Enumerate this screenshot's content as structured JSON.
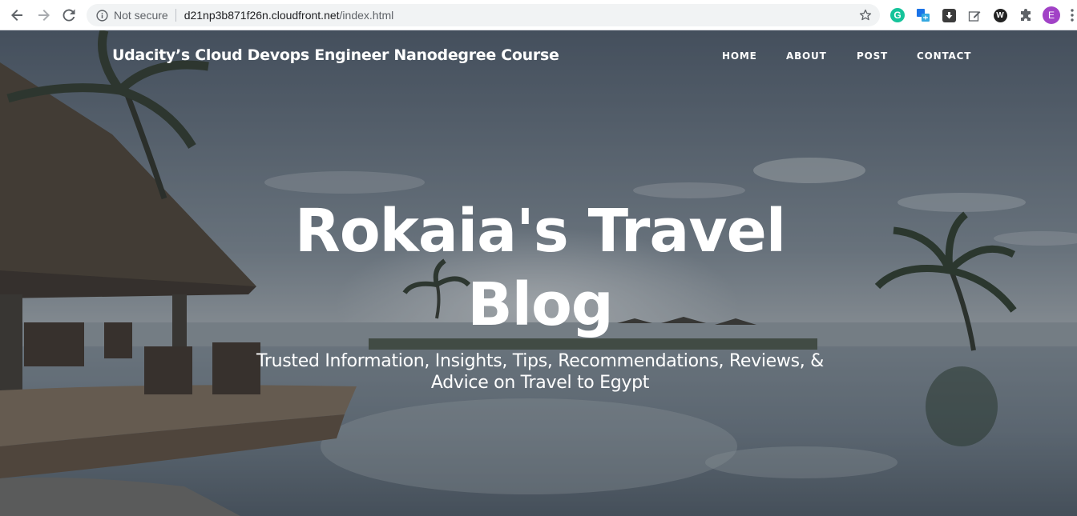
{
  "browser": {
    "security_label": "Not secure",
    "url_host": "d21np3b871f26n.cloudfront.net",
    "url_path": "/index.html",
    "profile_initial": "E",
    "extensions": {
      "grammarly_letter": "G",
      "w_letter": "W"
    },
    "colors": {
      "grammarly": "#15c39a",
      "profile": "#a142c6"
    }
  },
  "site": {
    "brand": "Udacity’s Cloud Devops Engineer Nanodegree Course",
    "nav": [
      "HOME",
      "ABOUT",
      "POST",
      "CONTACT"
    ],
    "hero": {
      "title_line1": "Rokaia's Travel",
      "title_line2": "Blog",
      "subtitle_line1": "Trusted Information, Insights, Tips, Recommendations, Reviews, &",
      "subtitle_line2": "Advice on Travel to Egypt"
    }
  }
}
